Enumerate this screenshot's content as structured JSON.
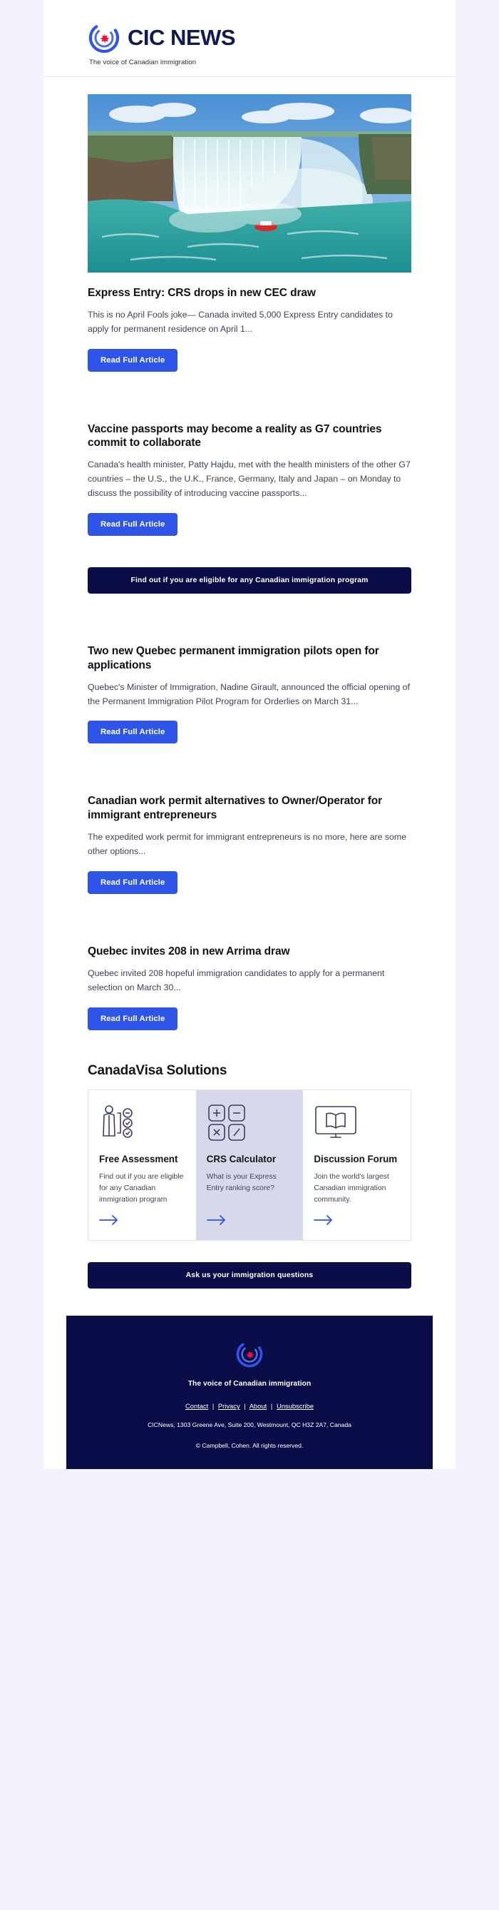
{
  "brand": {
    "name": "CIC NEWS",
    "tagline": "The voice of Canadian immigration",
    "logo_icon": "cic-circle-maple-leaf-logo",
    "accent_blue": "#2f55e8",
    "dark_navy": "#0a0d47",
    "logo_navy": "#121a4f",
    "maple_red": "#e8123c"
  },
  "articles": [
    {
      "image_alt": "niagara-falls-photo",
      "title": "Express Entry: CRS drops in new CEC draw",
      "body": "This is no April Fools joke— Canada invited 5,000 Express Entry candidates to apply for permanent residence on April 1...",
      "button_label": "Read Full Article",
      "has_image": true
    },
    {
      "title": "Vaccine passports may become a reality as G7 countries commit to collaborate",
      "body": "Canada's health minister, Patty Hajdu, met with the health ministers of the other G7 countries – the U.S., the U.K., France, Germany, Italy and Japan – on Monday to discuss the possibility of introducing vaccine passports...",
      "button_label": "Read Full Article",
      "has_image": false
    },
    {
      "title": "Two new Quebec permanent immigration pilots open for applications",
      "body": "Quebec's Minister of Immigration, Nadine Girault, announced the official opening of the Permanent Immigration Pilot Program for Orderlies on March 31...",
      "button_label": "Read Full Article",
      "has_image": false
    },
    {
      "title": "Canadian work permit alternatives to Owner/Operator for immigrant entrepreneurs",
      "body": "The expedited work permit for immigrant entrepreneurs is no more, here are some other options...",
      "button_label": "Read Full Article",
      "has_image": false
    },
    {
      "title": "Quebec invites 208 in new Arrima draw",
      "body": "Quebec invited 208 hopeful immigration candidates to apply for a permanent selection on March 30...",
      "button_label": "Read Full Article",
      "has_image": false
    }
  ],
  "banner_eligibility": "Find out if you are eligible for any Canadian immigration program",
  "banner_questions": "Ask us your immigration questions",
  "solutions": {
    "heading": "CanadaVisa Solutions",
    "cards": [
      {
        "icon": "person-checklist-icon",
        "title": "Free Assessment",
        "text": "Find out if you are eligible for any Canadian immigration program",
        "arrow": "arrow-right-icon",
        "highlighted": false
      },
      {
        "icon": "calculator-icon",
        "title": "CRS Calculator",
        "text": "What is your Express Entry ranking score?",
        "arrow": "arrow-right-icon",
        "highlighted": true
      },
      {
        "icon": "monitor-book-icon",
        "title": "Discussion Forum",
        "text": "Join the world's largest Canadian immigration community.",
        "arrow": "arrow-right-icon",
        "highlighted": false
      }
    ]
  },
  "footer": {
    "logo_icon": "cic-circle-maple-leaf-logo",
    "tagline": "The voice of Canadian immigration",
    "links": [
      "Contact",
      "Privacy",
      "About",
      "Unsubscribe"
    ],
    "separator": "|",
    "address": "CICNews, 1303 Greene Ave, Suite 200, Westmount, QC H3Z 2A7, Canada",
    "copyright": "© Campbell, Cohen. All rights reserved."
  }
}
